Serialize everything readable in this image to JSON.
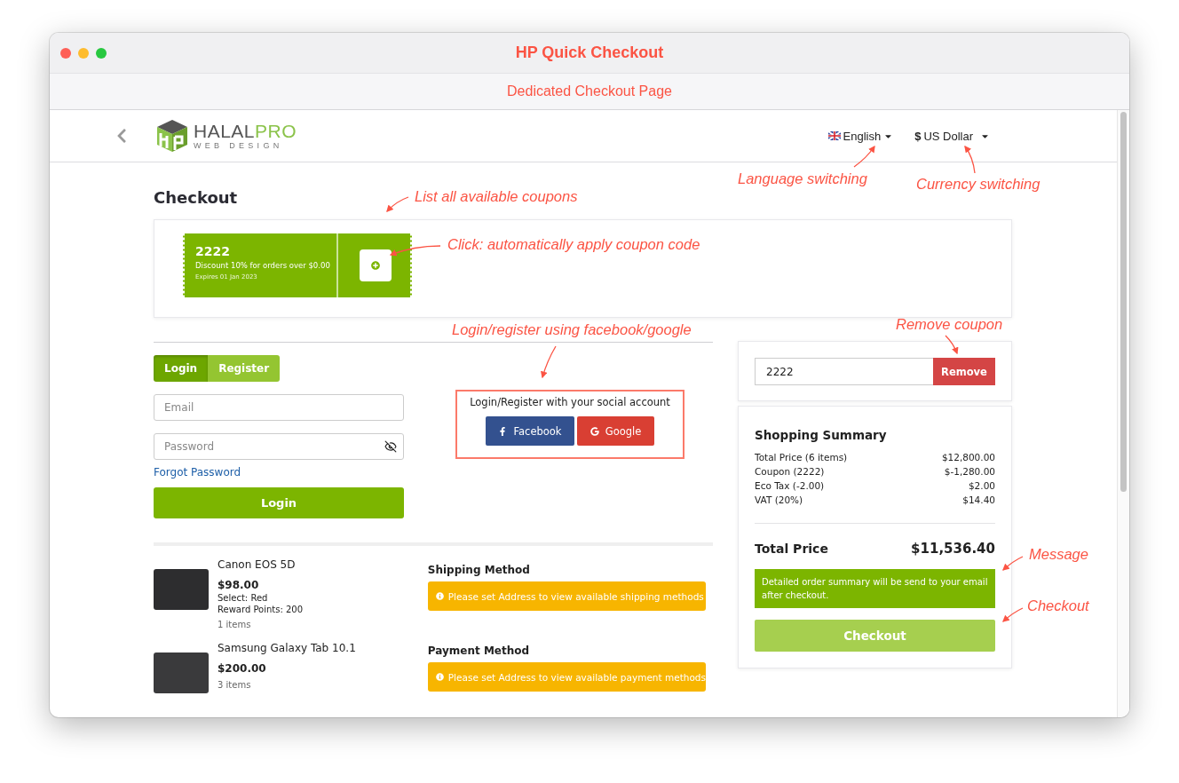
{
  "window": {
    "title": "HP Quick Checkout",
    "subtitle": "Dedicated Checkout Page"
  },
  "header": {
    "logo": {
      "word_1": "HALAL",
      "word_2": "PRO",
      "tagline": "WEB DESIGN"
    },
    "language": "English",
    "currency": {
      "symbol": "$",
      "label": "US Dollar"
    }
  },
  "heading": "Checkout",
  "coupons": [
    {
      "code": "2222",
      "description": "Discount 10% for orders over $0.00",
      "expires": "Expires 01 Jan 2023"
    }
  ],
  "auth": {
    "tabs": [
      {
        "label": "Login",
        "selected": true
      },
      {
        "label": "Register",
        "selected": false
      }
    ],
    "email": {
      "placeholder": "Email"
    },
    "password": {
      "placeholder": "Password"
    },
    "forgot_link": "Forgot Password",
    "submit": "Login",
    "social": {
      "prompt": "Login/Register with your social account",
      "buttons": [
        {
          "kind": "facebook",
          "label": "Facebook"
        },
        {
          "kind": "google",
          "label": "Google"
        }
      ]
    }
  },
  "products": [
    {
      "name": "Canon EOS 5D",
      "price": "$98.00",
      "details": [
        "Select: Red",
        "Reward Points: 200"
      ],
      "quantity": "1 items"
    },
    {
      "name": "Samsung Galaxy Tab 10.1",
      "price": "$200.00",
      "quantity": "3 items"
    }
  ],
  "methods": [
    {
      "title": "Shipping Method",
      "notice": "Please set Address to view available shipping methods"
    },
    {
      "title": "Payment Method",
      "notice": "Please set Address to view available payment methods"
    }
  ],
  "applied_coupon": {
    "value": "2222",
    "button": "Remove"
  },
  "summary": {
    "title": "Shopping Summary",
    "lines": [
      {
        "label": "Total Price (6 items)",
        "value": "$12,800.00"
      },
      {
        "label": "Coupon (2222)",
        "value": "$-1,280.00"
      },
      {
        "label": "Eco Tax (-2.00)",
        "value": "$2.00"
      },
      {
        "label": "VAT (20%)",
        "value": "$14.40"
      }
    ],
    "total_label": "Total Price",
    "total_value": "$11,536.40",
    "message": "Detailed order summary will be send to your email after checkout.",
    "checkout": "Checkout"
  },
  "annotations": [
    {
      "text": "Language switching"
    },
    {
      "text": "Currency switching"
    },
    {
      "text": "List all available coupons"
    },
    {
      "text": "Click: automatically apply coupon code"
    },
    {
      "text": "Login/register using facebook/google"
    },
    {
      "text": "Remove coupon"
    },
    {
      "text": "Message"
    },
    {
      "text": "Checkout"
    }
  ]
}
